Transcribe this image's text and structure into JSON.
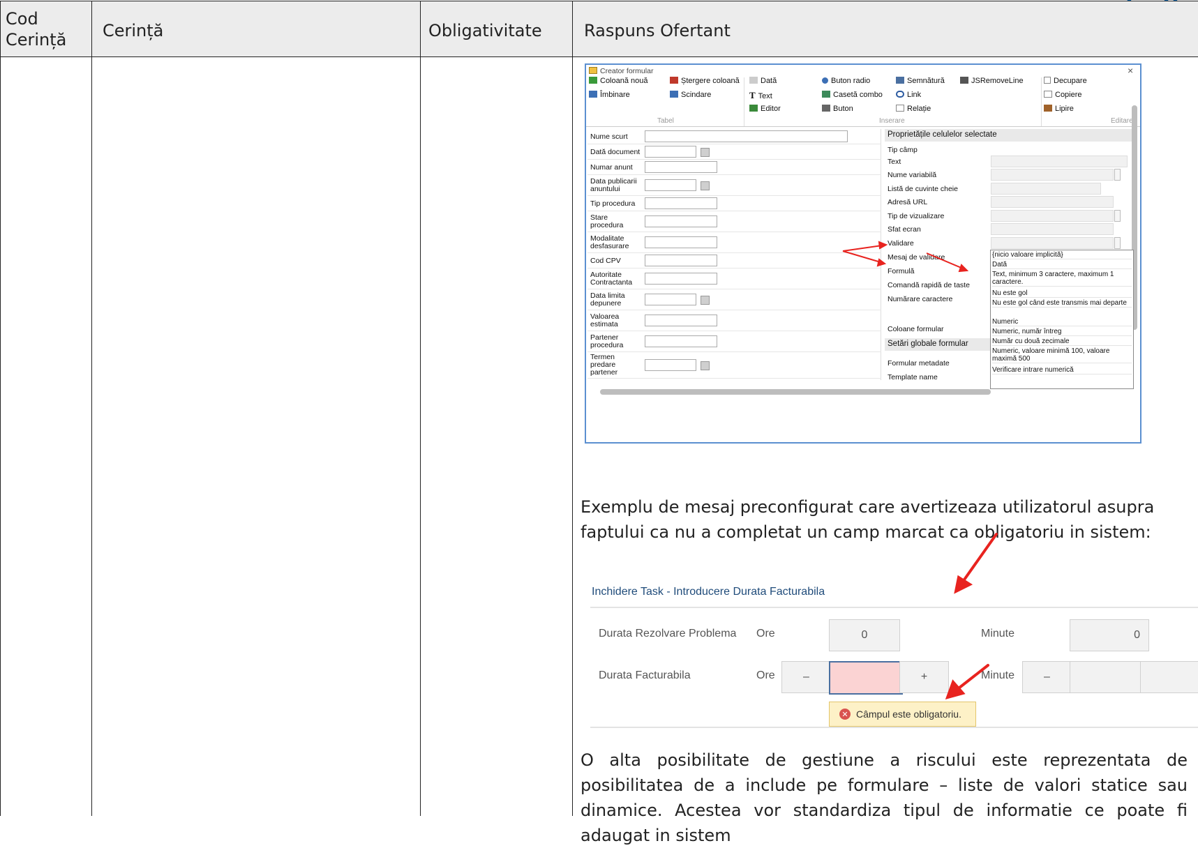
{
  "table": {
    "headers": [
      "Cod Cerință",
      "Cerință",
      "Obligativitate",
      "Raspuns Ofertant"
    ],
    "header_cod_line1": "Cod",
    "header_cod_line2": "Cerință"
  },
  "form_designer": {
    "window_title": "Creator formular",
    "close_symbol": "×",
    "toolbar": {
      "col_noua": "Coloană nouă",
      "stergere_coloana": "Ștergere coloană",
      "data": "Dată",
      "buton_radio": "Buton radio",
      "semnatura": "Semnătură",
      "jsremoveline": "JSRemoveLine",
      "decupare": "Decupare",
      "imbinare": "Îmbinare",
      "scindare": "Scindare",
      "text": "Text",
      "caseta_combo": "Casetă combo",
      "link": "Link",
      "copiere": "Copiere",
      "editor": "Editor",
      "buton": "Buton",
      "relatie": "Relație",
      "lipire": "Lipire",
      "group_tabel": "Tabel",
      "group_inserare": "Inserare",
      "group_editare": "Editare"
    },
    "form_fields": [
      "Nume scurt",
      "Dată document",
      "Numar anunt",
      "Data publicarii anuntului",
      "Tip procedura",
      "Stare procedura",
      "Modalitate desfasurare",
      "Cod CPV",
      "Autoritate Contractanta",
      "Data limita depunere",
      "Valoarea estimata",
      "Partener procedura",
      "Termen predare partener"
    ],
    "properties_title": "Proprietățile celulelor selectate",
    "properties": [
      "Tip câmp",
      "Text",
      "Nume variabilă",
      "Listă de cuvinte cheie",
      "Adresă URL",
      "Tip de vizualizare",
      "Sfat ecran",
      "Validare",
      "Mesaj de validare",
      "Formulă",
      "Comandă rapidă de taste",
      "Numărare caractere",
      "Coloane formular"
    ],
    "global_settings_title": "Setări globale formular",
    "global_settings": [
      "Formular metadate",
      "Template name"
    ],
    "validation_options": [
      "{nicio valoare implicită}",
      "Dată",
      "Text, minimum 3 caractere, maximum 1 caractere.",
      "Nu este gol",
      "Nu este gol când este transmis mai departe",
      "Numeric",
      "Numeric, număr întreg",
      "Număr cu două zecimale",
      "Numeric, valoare minimă 100, valoare maximă 500",
      "Verificare intrare numerică"
    ]
  },
  "paragraph1": "Exemplu de mesaj preconfigurat care avertizeaza utilizatorul asupra faptului ca nu a completat un camp marcat ca obligatoriu in sistem:",
  "error_demo": {
    "title": "Inchidere Task - Introducere Durata Facturabila",
    "row1_label": "Durata Rezolvare Problema",
    "row1_ore": "Ore",
    "row1_ore_value": "0",
    "row1_minute": "Minute",
    "row1_minute_value": "0",
    "row2_label": "Durata Facturabila",
    "row2_ore": "Ore",
    "row2_minus": "–",
    "row2_plus": "+",
    "row2_minute": "Minute",
    "row2_minus2": "–",
    "error_message": "Câmpul este obligatoriu."
  },
  "paragraph2": "O alta posibilitate de gestiune a riscului este reprezentata de posibilitatea de a include pe formulare – liste de valori statice sau dinamice. Acestea vor standardiza tipul de informatie ce poate fi adaugat in sistem",
  "colors": {
    "header_bg": "#ececec",
    "accent_red": "#e8231f",
    "error_field": "#fbd3d3",
    "tooltip_bg": "#fdf1c7",
    "link_blue": "#1f4b7a"
  }
}
